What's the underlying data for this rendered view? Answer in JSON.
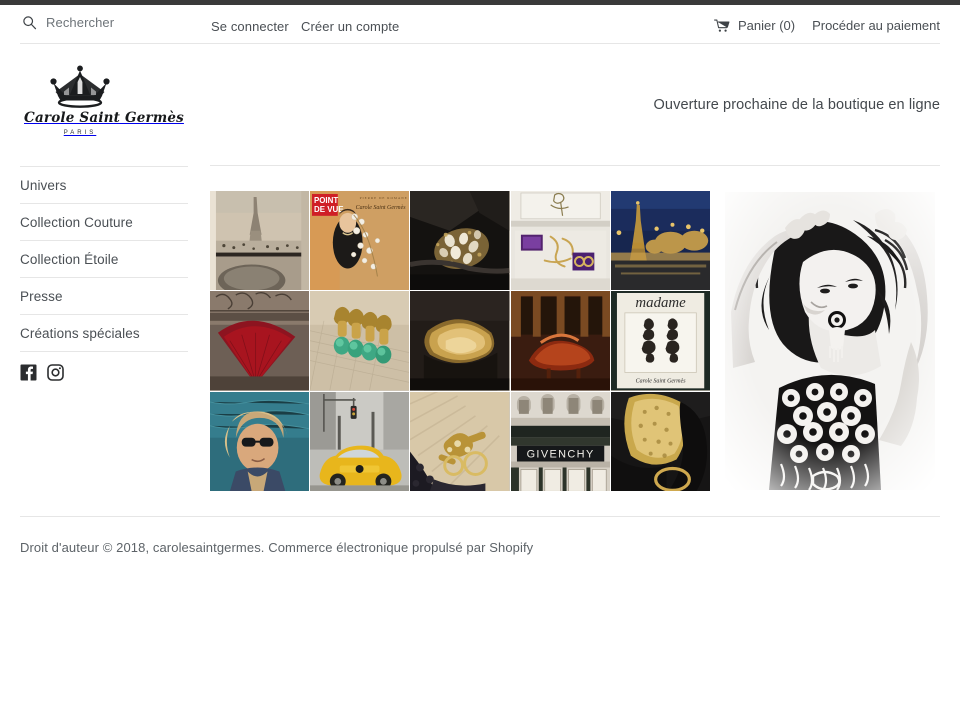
{
  "top": {
    "search": {
      "icon": "search-icon",
      "placeholder": "Rechercher"
    },
    "links": [
      {
        "label": "Se connecter",
        "name": "login-link"
      },
      {
        "label": "Créer un compte",
        "name": "create-account-link"
      }
    ],
    "cart": {
      "icon": "cart-icon",
      "label": "Panier (0)",
      "count": 0
    },
    "checkout": {
      "label": "Procéder au paiement"
    }
  },
  "brand": {
    "icon": "crown-icon",
    "name": "Carole Saint Germès",
    "city": "PARIS"
  },
  "tagline": "Ouverture prochaine de la boutique en ligne",
  "sidebar": {
    "items": [
      {
        "label": "Univers",
        "name": "sidebar-item-univers"
      },
      {
        "label": "Collection Couture",
        "name": "sidebar-item-collection-couture"
      },
      {
        "label": "Collection Étoile",
        "name": "sidebar-item-collection-etoile"
      },
      {
        "label": "Presse",
        "name": "sidebar-item-presse"
      },
      {
        "label": "Créations spéciales",
        "name": "sidebar-item-creations-speciales"
      }
    ],
    "socials": [
      {
        "name": "facebook-icon",
        "label": "Facebook"
      },
      {
        "name": "instagram-icon",
        "label": "Instagram"
      }
    ]
  },
  "gallery": {
    "columns": 5,
    "rows": 3,
    "tiles": [
      {
        "name": "gallery-tile-eiffel-tower-window",
        "alt": "Vue de la tour Eiffel depuis une fenêtre"
      },
      {
        "name": "gallery-tile-point-de-vue-magazine",
        "alt": "Couverture magazine Point de Vue",
        "text": "POINT DE VUE"
      },
      {
        "name": "gallery-tile-jewelled-clutch",
        "alt": "Pochette noire avec bijoux"
      },
      {
        "name": "gallery-tile-display-case",
        "alt": "Vitrine de bijoux"
      },
      {
        "name": "gallery-tile-eiffel-night",
        "alt": "Tour Eiffel de nuit"
      },
      {
        "name": "gallery-tile-red-fan",
        "alt": "Éventail rouge dans un escalier"
      },
      {
        "name": "gallery-tile-green-earrings",
        "alt": "Boucles d'oreilles vertes dorées"
      },
      {
        "name": "gallery-tile-gold-cuff",
        "alt": "Bracelet manchette doré"
      },
      {
        "name": "gallery-tile-grand-piano",
        "alt": "Piano à queue en vitrine"
      },
      {
        "name": "gallery-tile-madame-magazine",
        "alt": "Page magazine madame",
        "text": "madame"
      },
      {
        "name": "gallery-tile-portrait-sunglasses",
        "alt": "Portrait femme avec lunettes de soleil"
      },
      {
        "name": "gallery-tile-yellow-taxi",
        "alt": "Taxi jaune new-yorkais sous la neige"
      },
      {
        "name": "gallery-tile-bracelet-detail",
        "alt": "Détail bracelet doré"
      },
      {
        "name": "gallery-tile-givenchy-storefront",
        "alt": "Devanture Givenchy",
        "text": "GIVENCHY"
      },
      {
        "name": "gallery-tile-gold-cuff-black",
        "alt": "Manchette dorée sur cuir noir"
      }
    ]
  },
  "hero": {
    "name": "hero-portrait",
    "alt": "Portrait noir et blanc d'une femme aux bras levés portant des bijoux"
  },
  "footer": {
    "text": "Droit d'auteur © 2018, carolesaintgermes. Commerce électronique propulsé par Shopify"
  },
  "colors": {
    "rule": "#e6e6e6",
    "text": "#4a4f54",
    "muted": "#6e7479",
    "topstrip": "#3a3a3a"
  }
}
